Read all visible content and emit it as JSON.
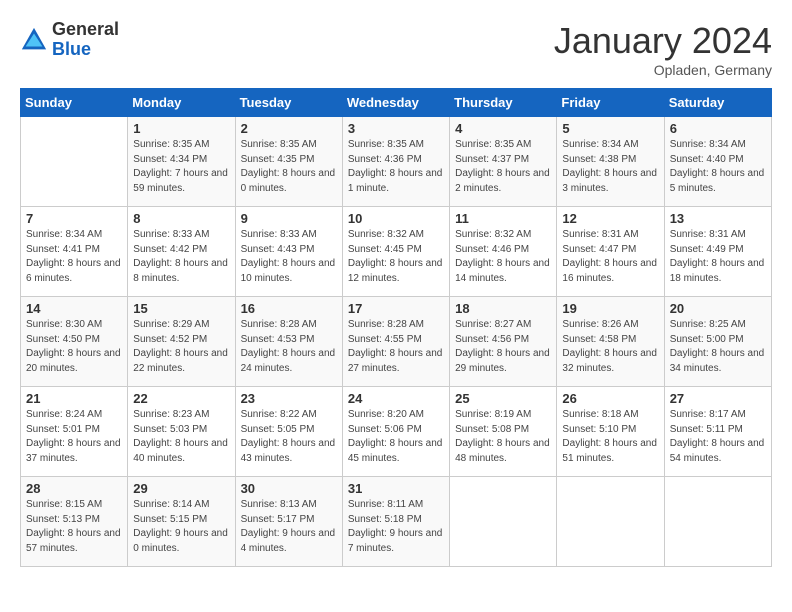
{
  "logo": {
    "general": "General",
    "blue": "Blue"
  },
  "header": {
    "month": "January 2024",
    "location": "Opladen, Germany"
  },
  "weekdays": [
    "Sunday",
    "Monday",
    "Tuesday",
    "Wednesday",
    "Thursday",
    "Friday",
    "Saturday"
  ],
  "weeks": [
    [
      {
        "day": "",
        "sunrise": "",
        "sunset": "",
        "daylight": ""
      },
      {
        "day": "1",
        "sunrise": "Sunrise: 8:35 AM",
        "sunset": "Sunset: 4:34 PM",
        "daylight": "Daylight: 7 hours and 59 minutes."
      },
      {
        "day": "2",
        "sunrise": "Sunrise: 8:35 AM",
        "sunset": "Sunset: 4:35 PM",
        "daylight": "Daylight: 8 hours and 0 minutes."
      },
      {
        "day": "3",
        "sunrise": "Sunrise: 8:35 AM",
        "sunset": "Sunset: 4:36 PM",
        "daylight": "Daylight: 8 hours and 1 minute."
      },
      {
        "day": "4",
        "sunrise": "Sunrise: 8:35 AM",
        "sunset": "Sunset: 4:37 PM",
        "daylight": "Daylight: 8 hours and 2 minutes."
      },
      {
        "day": "5",
        "sunrise": "Sunrise: 8:34 AM",
        "sunset": "Sunset: 4:38 PM",
        "daylight": "Daylight: 8 hours and 3 minutes."
      },
      {
        "day": "6",
        "sunrise": "Sunrise: 8:34 AM",
        "sunset": "Sunset: 4:40 PM",
        "daylight": "Daylight: 8 hours and 5 minutes."
      }
    ],
    [
      {
        "day": "7",
        "sunrise": "Sunrise: 8:34 AM",
        "sunset": "Sunset: 4:41 PM",
        "daylight": "Daylight: 8 hours and 6 minutes."
      },
      {
        "day": "8",
        "sunrise": "Sunrise: 8:33 AM",
        "sunset": "Sunset: 4:42 PM",
        "daylight": "Daylight: 8 hours and 8 minutes."
      },
      {
        "day": "9",
        "sunrise": "Sunrise: 8:33 AM",
        "sunset": "Sunset: 4:43 PM",
        "daylight": "Daylight: 8 hours and 10 minutes."
      },
      {
        "day": "10",
        "sunrise": "Sunrise: 8:32 AM",
        "sunset": "Sunset: 4:45 PM",
        "daylight": "Daylight: 8 hours and 12 minutes."
      },
      {
        "day": "11",
        "sunrise": "Sunrise: 8:32 AM",
        "sunset": "Sunset: 4:46 PM",
        "daylight": "Daylight: 8 hours and 14 minutes."
      },
      {
        "day": "12",
        "sunrise": "Sunrise: 8:31 AM",
        "sunset": "Sunset: 4:47 PM",
        "daylight": "Daylight: 8 hours and 16 minutes."
      },
      {
        "day": "13",
        "sunrise": "Sunrise: 8:31 AM",
        "sunset": "Sunset: 4:49 PM",
        "daylight": "Daylight: 8 hours and 18 minutes."
      }
    ],
    [
      {
        "day": "14",
        "sunrise": "Sunrise: 8:30 AM",
        "sunset": "Sunset: 4:50 PM",
        "daylight": "Daylight: 8 hours and 20 minutes."
      },
      {
        "day": "15",
        "sunrise": "Sunrise: 8:29 AM",
        "sunset": "Sunset: 4:52 PM",
        "daylight": "Daylight: 8 hours and 22 minutes."
      },
      {
        "day": "16",
        "sunrise": "Sunrise: 8:28 AM",
        "sunset": "Sunset: 4:53 PM",
        "daylight": "Daylight: 8 hours and 24 minutes."
      },
      {
        "day": "17",
        "sunrise": "Sunrise: 8:28 AM",
        "sunset": "Sunset: 4:55 PM",
        "daylight": "Daylight: 8 hours and 27 minutes."
      },
      {
        "day": "18",
        "sunrise": "Sunrise: 8:27 AM",
        "sunset": "Sunset: 4:56 PM",
        "daylight": "Daylight: 8 hours and 29 minutes."
      },
      {
        "day": "19",
        "sunrise": "Sunrise: 8:26 AM",
        "sunset": "Sunset: 4:58 PM",
        "daylight": "Daylight: 8 hours and 32 minutes."
      },
      {
        "day": "20",
        "sunrise": "Sunrise: 8:25 AM",
        "sunset": "Sunset: 5:00 PM",
        "daylight": "Daylight: 8 hours and 34 minutes."
      }
    ],
    [
      {
        "day": "21",
        "sunrise": "Sunrise: 8:24 AM",
        "sunset": "Sunset: 5:01 PM",
        "daylight": "Daylight: 8 hours and 37 minutes."
      },
      {
        "day": "22",
        "sunrise": "Sunrise: 8:23 AM",
        "sunset": "Sunset: 5:03 PM",
        "daylight": "Daylight: 8 hours and 40 minutes."
      },
      {
        "day": "23",
        "sunrise": "Sunrise: 8:22 AM",
        "sunset": "Sunset: 5:05 PM",
        "daylight": "Daylight: 8 hours and 43 minutes."
      },
      {
        "day": "24",
        "sunrise": "Sunrise: 8:20 AM",
        "sunset": "Sunset: 5:06 PM",
        "daylight": "Daylight: 8 hours and 45 minutes."
      },
      {
        "day": "25",
        "sunrise": "Sunrise: 8:19 AM",
        "sunset": "Sunset: 5:08 PM",
        "daylight": "Daylight: 8 hours and 48 minutes."
      },
      {
        "day": "26",
        "sunrise": "Sunrise: 8:18 AM",
        "sunset": "Sunset: 5:10 PM",
        "daylight": "Daylight: 8 hours and 51 minutes."
      },
      {
        "day": "27",
        "sunrise": "Sunrise: 8:17 AM",
        "sunset": "Sunset: 5:11 PM",
        "daylight": "Daylight: 8 hours and 54 minutes."
      }
    ],
    [
      {
        "day": "28",
        "sunrise": "Sunrise: 8:15 AM",
        "sunset": "Sunset: 5:13 PM",
        "daylight": "Daylight: 8 hours and 57 minutes."
      },
      {
        "day": "29",
        "sunrise": "Sunrise: 8:14 AM",
        "sunset": "Sunset: 5:15 PM",
        "daylight": "Daylight: 9 hours and 0 minutes."
      },
      {
        "day": "30",
        "sunrise": "Sunrise: 8:13 AM",
        "sunset": "Sunset: 5:17 PM",
        "daylight": "Daylight: 9 hours and 4 minutes."
      },
      {
        "day": "31",
        "sunrise": "Sunrise: 8:11 AM",
        "sunset": "Sunset: 5:18 PM",
        "daylight": "Daylight: 9 hours and 7 minutes."
      },
      {
        "day": "",
        "sunrise": "",
        "sunset": "",
        "daylight": ""
      },
      {
        "day": "",
        "sunrise": "",
        "sunset": "",
        "daylight": ""
      },
      {
        "day": "",
        "sunrise": "",
        "sunset": "",
        "daylight": ""
      }
    ]
  ]
}
